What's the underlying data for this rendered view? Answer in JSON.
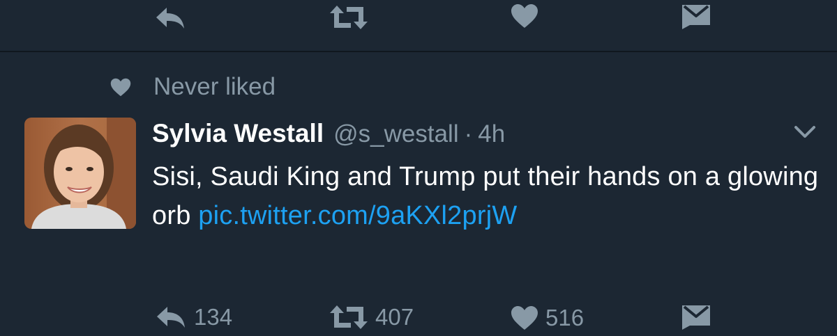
{
  "previous_tweet": {
    "actions": [
      {
        "name": "reply",
        "icon": "reply-icon"
      },
      {
        "name": "retweet",
        "icon": "retweet-icon"
      },
      {
        "name": "like",
        "icon": "heart-icon"
      },
      {
        "name": "direct-message",
        "icon": "envelope-icon"
      }
    ]
  },
  "social_context": {
    "icon": "heart-icon",
    "text": "Never liked"
  },
  "tweet": {
    "display_name": "Sylvia Westall",
    "handle": "@s_westall",
    "separator": "·",
    "time": "4h",
    "text": "Sisi, Saudi King and Trump put their hands on a glowing orb ",
    "link": "pic.twitter.com/9aKXl2prjW",
    "reply_count": "134",
    "retweet_count": "407",
    "like_count": "516",
    "menu_icon": "chevron-down-icon"
  },
  "colors": {
    "background": "#1c2733",
    "icon_gray": "#8899a6",
    "link_blue": "#1da1f2",
    "text_white": "#ffffff"
  }
}
